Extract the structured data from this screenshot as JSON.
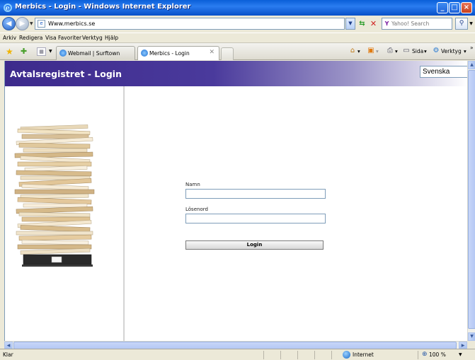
{
  "window": {
    "title": "Merbics - Login - Windows Internet Explorer"
  },
  "address_bar": {
    "url": "Www.merbics.se",
    "search_placeholder": "Yahoo! Search"
  },
  "menu": {
    "items": [
      "Arkiv",
      "Redigera",
      "Visa",
      "Favoriter",
      "Verktyg",
      "Hjälp"
    ]
  },
  "tabs": [
    {
      "label": "Webmail | Surftown"
    },
    {
      "label": "Merbics - Login"
    }
  ],
  "command_bar": {
    "page_label": "Sida",
    "tools_label": "Verktyg"
  },
  "page": {
    "title": "Avtalsregistret - Login",
    "language": "Svenska",
    "name_label": "Namn",
    "password_label": "Lösenord",
    "login_button": "Login"
  },
  "status_bar": {
    "status": "Klar",
    "zone": "Internet",
    "zoom": "100 %"
  },
  "colors": {
    "banner_start": "#3d2a8c",
    "banner_end": "#ffffff",
    "titlebar": "#0a5fd8"
  }
}
